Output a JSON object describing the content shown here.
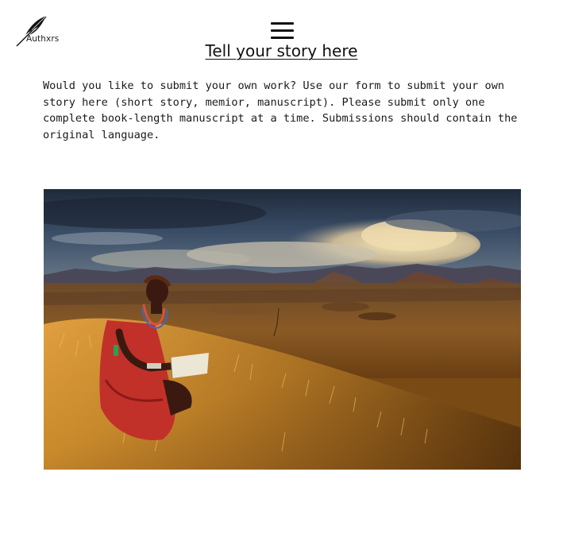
{
  "logo": {
    "text": "Authxrs",
    "icon": "feather-quill-icon"
  },
  "header": {
    "menu_icon": "hamburger-menu-icon"
  },
  "page": {
    "title": "Tell your story here",
    "intro": "Would you like to submit your own work? Use our form to submit your own story here (short story, memior, manuscript). Please submit only one complete book-length manuscript at a time. Submissions should contain the original language."
  },
  "hero": {
    "description_icon": "landscape-photo"
  }
}
